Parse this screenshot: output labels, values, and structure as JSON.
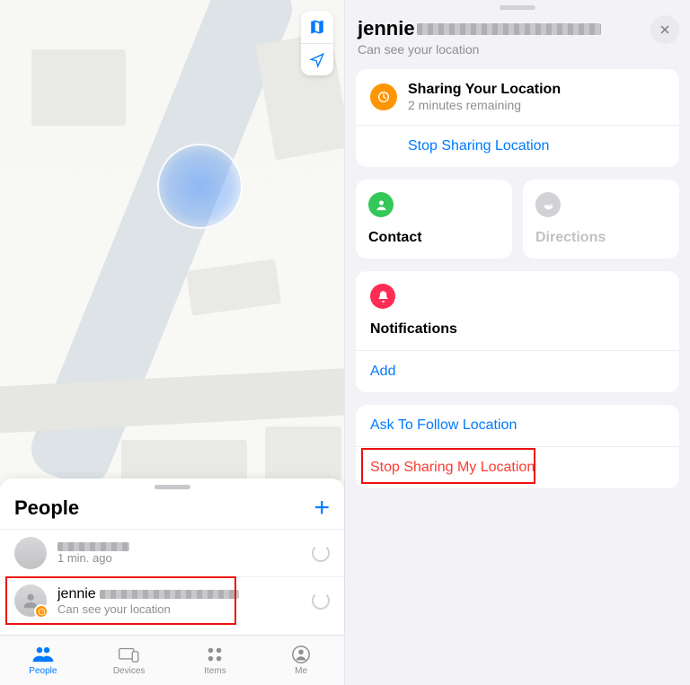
{
  "left": {
    "sheet_title": "People",
    "items": [
      {
        "name_redacted": true,
        "subtitle": "1 min. ago",
        "loading": true
      },
      {
        "name_prefix": "jennie",
        "name_redacted": true,
        "subtitle": "Can see your location",
        "loading": true,
        "highlighted": true
      }
    ],
    "tabs": [
      {
        "label": "People",
        "active": true
      },
      {
        "label": "Devices"
      },
      {
        "label": "Items"
      },
      {
        "label": "Me"
      }
    ]
  },
  "right": {
    "name_prefix": "jennie",
    "subtitle": "Can see your location",
    "sharing": {
      "title": "Sharing Your Location",
      "subtitle": "2 minutes remaining",
      "stop_link": "Stop Sharing Location"
    },
    "actions": {
      "contact": "Contact",
      "directions": "Directions"
    },
    "notifications": {
      "title": "Notifications",
      "add": "Add"
    },
    "bottom": {
      "ask": "Ask To Follow Location",
      "stop": "Stop Sharing My Location"
    }
  }
}
